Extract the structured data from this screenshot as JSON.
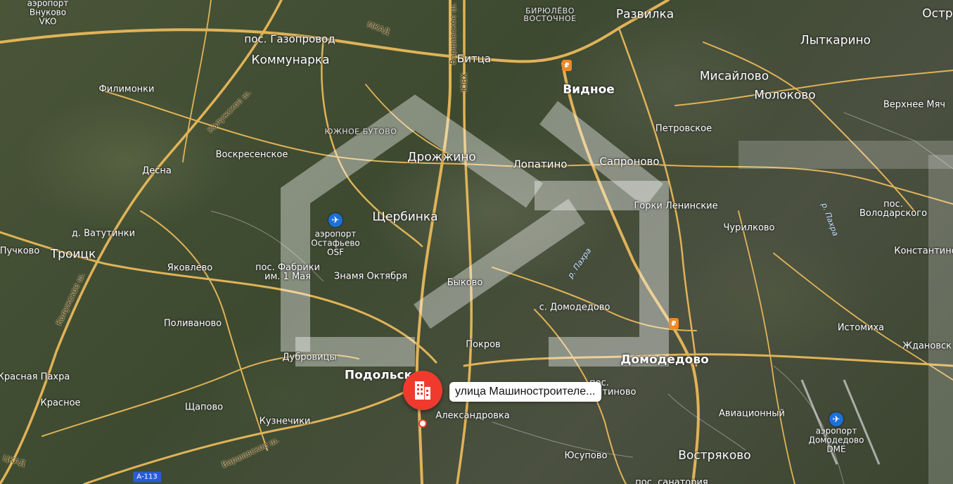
{
  "map": {
    "selected_location": {
      "label": "улица Машиностроителе...",
      "icon": "building-icon"
    },
    "watermark": {
      "icon": "house-logo-icon"
    },
    "airports": [
      {
        "id": "vnukovo",
        "name": "аэропорт\nВнуково\nVKO"
      },
      {
        "id": "ostafyevo",
        "name": "аэропорт\nОстафьево\nOSF"
      },
      {
        "id": "domodedovo",
        "name": "аэропорт\nДомодедово\nDME"
      }
    ],
    "labels": {
      "kommunarka": "Коммунарка",
      "gazoprovod": "пос. Газопровод",
      "mkad": "МКАД",
      "varshavskoe_top": "Варшавское ш.",
      "birulevo": "БИРЮЛЁВО\nВОСТОЧНОЕ",
      "razvilka": "Развилка",
      "ostr": "Остр",
      "lytkarino": "Лыткарино",
      "bitsa": "Битца",
      "yuvh": "ЮВХ",
      "vidnoe": "Видное",
      "misaylovo": "Мисайлово",
      "molokovo": "Молоково",
      "verkhnee": "Верхнее Мяч",
      "filimonki": "Филимонки",
      "kaluzhskoe_top": "Калужское ш.",
      "yuzhnoe_butovo": "ЮЖНОЕ БУТОВО",
      "petrovskoe": "Петровское",
      "voskresenskoe": "Воскресенское",
      "drozhzhino": "Дрожжино",
      "lopatino": "Лопатино",
      "sapronovo": "Сапроново",
      "desna": "Десна",
      "gorki": "Горки Ленинские",
      "pakhra_r1": "р. Пахра",
      "volodarskogo": "пос.\nВолодарского",
      "shcherbinka": "Щербинка",
      "vatutinki": "д. Ватутинки",
      "churilkovo": "Чурилково",
      "konstantinovo_e": "Константино",
      "puchkovo": "Пучково",
      "troitsk": "Троицк",
      "pakhra_r2": "р. Пахра",
      "yakovlevo": "Яковлево",
      "fabriki": "пос. Фабрики\nим. 1 Мая",
      "znamya": "Знамя Октября",
      "bykovo": "Быково",
      "kaluzhskoe_left": "Калужское ш.",
      "s_domodedovo": "с. Домодедово",
      "polivanovo": "Поливаново",
      "istomikha": "Истомиха",
      "pokrov": "Покров",
      "zhdanovsk": "Ждановск",
      "dubrovitsy": "Дубровицы",
      "podolsk": "Подольск",
      "domodedovo": "Домодедово",
      "krasnaya_pakhra": "Красная Пахра",
      "pos_konst": "пос.\nКонстантиново",
      "krasnoe": "Красное",
      "shchapovo": "Щапово",
      "aviatsionny": "Авиационный",
      "aleksandrovka": "Александровка",
      "kuznechiki": "Кузнечики",
      "varshavskoe_bottom": "Варшавское ш.",
      "mkad_bottom": "ЦКАД",
      "a113": "А-113",
      "yusupovo": "Юсупово",
      "vostryakovo": "Востряково",
      "sanatoriya": "пос. санатория"
    }
  }
}
